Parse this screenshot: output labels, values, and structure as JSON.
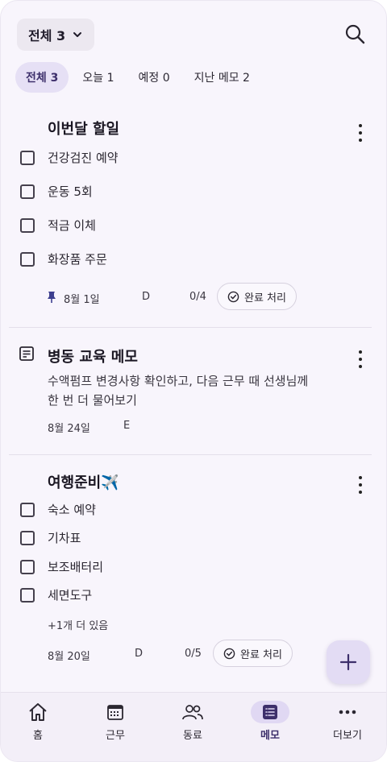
{
  "header": {
    "filter_label": "전체 3"
  },
  "tabs": [
    {
      "label": "전체 3",
      "active": true
    },
    {
      "label": "오늘 1",
      "active": false
    },
    {
      "label": "예정 0",
      "active": false
    },
    {
      "label": "지난 메모 2",
      "active": false
    }
  ],
  "cards": [
    {
      "type": "checklist",
      "title": "이번달 할일",
      "items": [
        "건강검진 예약",
        "운동 5회",
        "적금 이체",
        "화장품 주문"
      ],
      "date": "8월 1일",
      "pinned": true,
      "shift": "D",
      "progress": "0/4",
      "done_label": "완료 처리"
    },
    {
      "type": "note",
      "title": "병동 교육 메모",
      "body_line1": "수액펌프 변경사항 확인하고, 다음 근무 때 선생님께",
      "body_line2": "한 번 더 물어보기",
      "date": "8월 24일",
      "shift": "E"
    },
    {
      "type": "checklist",
      "title": "여행준비✈️",
      "items": [
        "숙소 예약",
        "기차표",
        "보조배터리",
        "세면도구"
      ],
      "more_label": "+1개 더 있음",
      "date": "8월 20일",
      "shift": "D",
      "progress": "0/5",
      "done_label": "완료 처리"
    }
  ],
  "nav": [
    {
      "label": "홈",
      "icon": "home-icon",
      "active": false
    },
    {
      "label": "근무",
      "icon": "calendar-icon",
      "active": false
    },
    {
      "label": "동료",
      "icon": "people-icon",
      "active": false
    },
    {
      "label": "메모",
      "icon": "memo-list-icon",
      "active": true
    },
    {
      "label": "더보기",
      "icon": "more-horiz-icon",
      "active": false
    }
  ],
  "colors": {
    "background": "#f8f5fc",
    "accent": "#3d2f6b",
    "active_chip": "#e6e0f5",
    "fab": "#e3dcf4"
  }
}
